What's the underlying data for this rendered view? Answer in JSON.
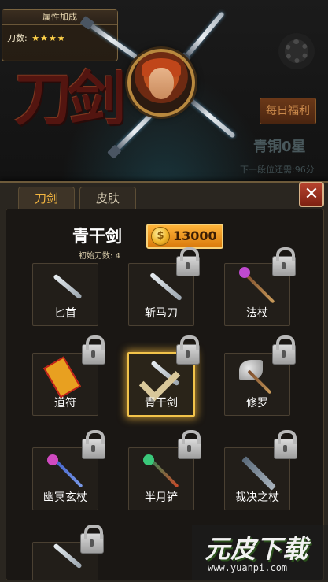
{
  "attributes": {
    "title": "属性加成",
    "knife_count_label": "刀数:",
    "stars": "★★★★"
  },
  "game_logo_text": "刀剑",
  "header": {
    "daily_bonus_label": "每日福利",
    "rank": "青铜0星",
    "next_level": "下一段位还需:96分"
  },
  "tabs": [
    {
      "label": "刀剑",
      "active": true
    },
    {
      "label": "皮肤",
      "active": false
    }
  ],
  "close_label": "✕",
  "selected_weapon": {
    "name": "青干剑",
    "initial_count": "初始刀数: 4",
    "price": "13000",
    "coin_glyph": "$"
  },
  "weapons": [
    {
      "label": "匕首",
      "locked": false,
      "icon": "dagger-icon"
    },
    {
      "label": "斩马刀",
      "locked": true,
      "icon": "machete-icon"
    },
    {
      "label": "法杖",
      "locked": true,
      "icon": "magic-staff-icon"
    },
    {
      "label": "道符",
      "locked": true,
      "icon": "talisman-icon"
    },
    {
      "label": "青干剑",
      "locked": true,
      "selected": true,
      "icon": "sword-icon"
    },
    {
      "label": "修罗",
      "locked": true,
      "icon": "axe-icon"
    },
    {
      "label": "幽冥玄杖",
      "locked": true,
      "icon": "dark-staff-icon"
    },
    {
      "label": "半月铲",
      "locked": true,
      "icon": "crescent-spade-icon"
    },
    {
      "label": "裁决之杖",
      "locked": true,
      "icon": "judgement-staff-icon"
    },
    {
      "label": "",
      "locked": true,
      "icon": "blade-icon"
    }
  ],
  "watermark": {
    "logo": "元皮下载",
    "url": "www.yuanpi.com"
  },
  "colors": {
    "accent_gold": "#f2c34a",
    "tab_active_text": "#f4b640",
    "price_button": "#ffb43a",
    "close_button": "#b5422d"
  }
}
